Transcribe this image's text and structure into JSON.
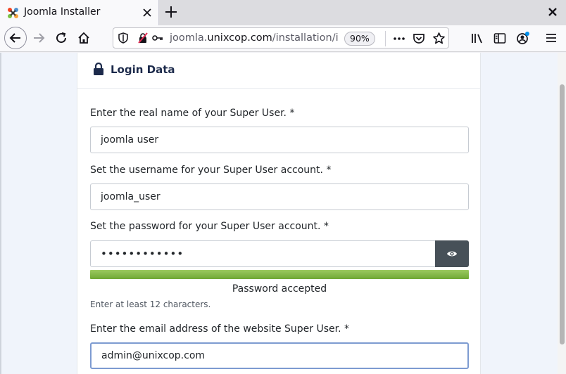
{
  "browser": {
    "tab_title": "Joomla Installer",
    "url": {
      "prefix": "joomla.",
      "domain": "unixcop.com",
      "path": "/installation/in"
    },
    "zoom": "90%"
  },
  "form": {
    "section_title": "Login Data",
    "fields": {
      "real_name": {
        "label": "Enter the real name of your Super User. *",
        "value": "joomla user"
      },
      "username": {
        "label": "Set the username for your Super User account. *",
        "value": "joomla_user"
      },
      "password": {
        "label": "Set the password for your Super User account. *",
        "value": "••••••••••••",
        "strength": 1.0,
        "strength_text": "Password accepted",
        "hint": "Enter at least 12 characters."
      },
      "email": {
        "label": "Enter the email address of the website Super User. *",
        "value": "admin@unixcop.com"
      }
    }
  },
  "colors": {
    "strength_bar": "#7ab03f",
    "eye_button": "#475058",
    "title": "#1c2a4b"
  }
}
